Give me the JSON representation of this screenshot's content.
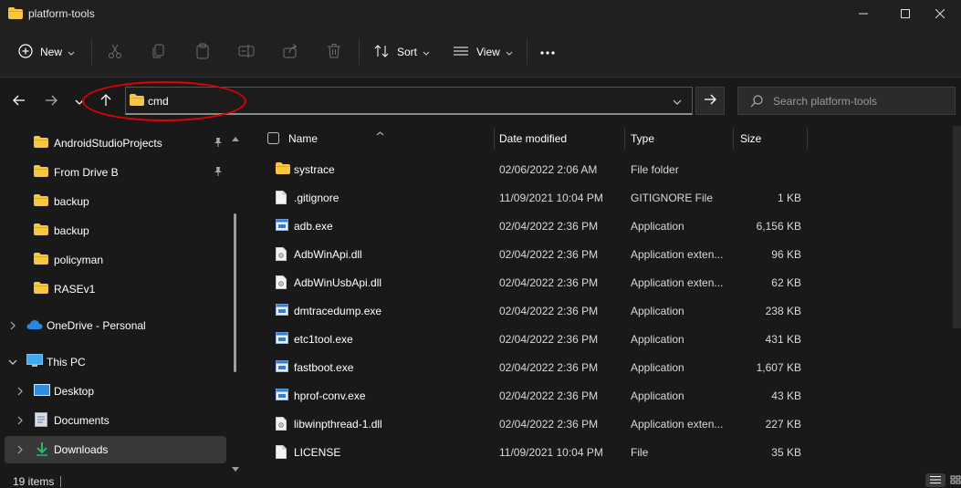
{
  "window": {
    "title": "platform-tools"
  },
  "toolbar": {
    "new_label": "New",
    "sort_label": "Sort",
    "view_label": "View"
  },
  "address": {
    "value": "cmd"
  },
  "search": {
    "placeholder": "Search platform-tools"
  },
  "sidebar": {
    "quick_access": [
      {
        "label": "AndroidStudioProjects",
        "pinned": true
      },
      {
        "label": "From Drive B",
        "pinned": true
      },
      {
        "label": "backup",
        "pinned": false
      },
      {
        "label": "backup",
        "pinned": false
      },
      {
        "label": "policyman",
        "pinned": false
      },
      {
        "label": "RASEv1",
        "pinned": false
      }
    ],
    "onedrive": "OneDrive - Personal",
    "this_pc": "This PC",
    "desktop": "Desktop",
    "documents": "Documents",
    "downloads": "Downloads"
  },
  "columns": {
    "name": "Name",
    "date": "Date modified",
    "type": "Type",
    "size": "Size"
  },
  "files": [
    {
      "name": "systrace",
      "date": "02/06/2022 2:06 AM",
      "type": "File folder",
      "size": "",
      "icon": "folder"
    },
    {
      "name": ".gitignore",
      "date": "11/09/2021 10:04 PM",
      "type": "GITIGNORE File",
      "size": "1 KB",
      "icon": "file"
    },
    {
      "name": "adb.exe",
      "date": "02/04/2022 2:36 PM",
      "type": "Application",
      "size": "6,156 KB",
      "icon": "exe"
    },
    {
      "name": "AdbWinApi.dll",
      "date": "02/04/2022 2:36 PM",
      "type": "Application exten...",
      "size": "96 KB",
      "icon": "dll"
    },
    {
      "name": "AdbWinUsbApi.dll",
      "date": "02/04/2022 2:36 PM",
      "type": "Application exten...",
      "size": "62 KB",
      "icon": "dll"
    },
    {
      "name": "dmtracedump.exe",
      "date": "02/04/2022 2:36 PM",
      "type": "Application",
      "size": "238 KB",
      "icon": "exe"
    },
    {
      "name": "etc1tool.exe",
      "date": "02/04/2022 2:36 PM",
      "type": "Application",
      "size": "431 KB",
      "icon": "exe"
    },
    {
      "name": "fastboot.exe",
      "date": "02/04/2022 2:36 PM",
      "type": "Application",
      "size": "1,607 KB",
      "icon": "exe"
    },
    {
      "name": "hprof-conv.exe",
      "date": "02/04/2022 2:36 PM",
      "type": "Application",
      "size": "43 KB",
      "icon": "exe"
    },
    {
      "name": "libwinpthread-1.dll",
      "date": "02/04/2022 2:36 PM",
      "type": "Application exten...",
      "size": "227 KB",
      "icon": "dll"
    },
    {
      "name": "LICENSE",
      "date": "11/09/2021 10:04 PM",
      "type": "File",
      "size": "35 KB",
      "icon": "file"
    }
  ],
  "status": {
    "count": "19 items"
  },
  "colors": {
    "folder": "#f7c744",
    "exe_blue": "#2f7fd6",
    "highlight": "#e00000",
    "background": "#191919"
  }
}
